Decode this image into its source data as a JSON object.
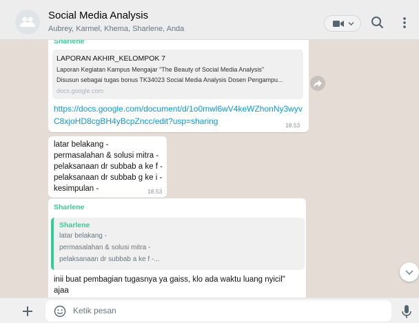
{
  "header": {
    "title": "Social Media Analysis",
    "members": "Aubrey, Karmel, Khema, Sharlene, Anda",
    "icons": [
      "group-avatar-icon",
      "video-call-icon",
      "chevron-down-icon",
      "search-icon",
      "more-options-icon"
    ]
  },
  "messages": [
    {
      "sender": "Sharlene",
      "preview": {
        "title": "LAPORAN AKHIR_KELOMPOK 7",
        "description_line1": "Laporan Kegiatan Kampus Mengajar \"The Beauty of Social Media Analysis\"",
        "description_line2": "Disusun sebagai tugas bonus TK34023 Social Media Analysis Dosen Pengampu...",
        "domain": "docs.google.com"
      },
      "link_line1": "https://docs.google.com/document/d/1o0mwl6wV4keWZhonNy3wyv",
      "link_line2": "C8xjoHD8cgBH4yBcpZncc/edit?usp=sharing",
      "time": "18.53"
    },
    {
      "lines": [
        "latar belakang -",
        "permasalahan & solusi mitra -",
        "pelaksanaan dr subbab a ke f -",
        "pelaksanaan dr subbab g ke i -",
        "kesimpulan -"
      ],
      "time": "18.53"
    },
    {
      "sender": "Sharlene",
      "quote": {
        "sender": "Sharlene",
        "lines": [
          "latar belakang -",
          "permasalahan & solusi mitra -",
          "pelaksanaan dr subbab a ke f -..."
        ]
      },
      "line1": "inii buat pembagian tugasnya ya gaiss, klo ada waktu luang nyicil\"",
      "line2": "ajaa"
    }
  ],
  "composer": {
    "placeholder": "Ketik pesan",
    "icons": [
      "plus-icon",
      "emoji-icon",
      "microphone-icon"
    ]
  },
  "colors": {
    "header_bg": "#ededed",
    "chat_bg": "#e5ddd5",
    "bubble_bg": "#ffffff",
    "sender_name": "#35cd96",
    "link": "#039be5",
    "quote_bar": "#35cd96"
  }
}
